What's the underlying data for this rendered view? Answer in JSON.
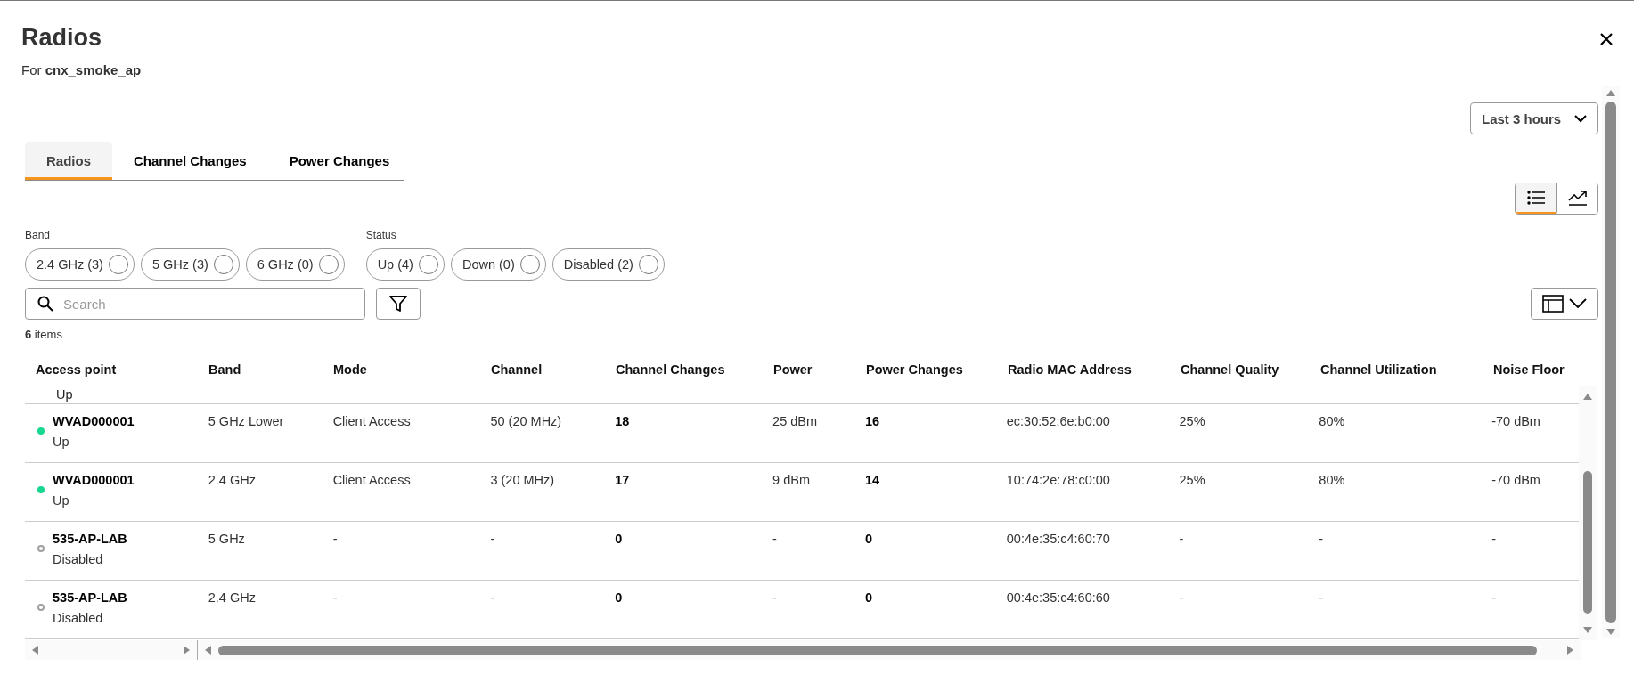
{
  "dialog": {
    "title": "Radios",
    "subtitle_prefix": "For",
    "subtitle_name": "cnx_smoke_ap"
  },
  "time_range": {
    "value": "Last 3 hours"
  },
  "tabs": [
    {
      "label": "Radios",
      "selected": true
    },
    {
      "label": "Channel Changes",
      "selected": false
    },
    {
      "label": "Power Changes",
      "selected": false
    }
  ],
  "view_toggle": [
    {
      "kind": "list",
      "selected": true
    },
    {
      "kind": "chart",
      "selected": false
    }
  ],
  "filters": [
    {
      "label": "Band",
      "chips": [
        {
          "label": "2.4 GHz (3)",
          "selected": false
        },
        {
          "label": "5 GHz (3)",
          "selected": false
        },
        {
          "label": "6 GHz (0)",
          "selected": false
        }
      ]
    },
    {
      "label": "Status",
      "chips": [
        {
          "label": "Up (4)",
          "selected": false
        },
        {
          "label": "Down (0)",
          "selected": false
        },
        {
          "label": "Disabled (2)",
          "selected": false
        }
      ]
    }
  ],
  "search": {
    "placeholder": "Search"
  },
  "item_count": {
    "count": "6",
    "label": "items"
  },
  "table": {
    "columns": [
      "Access point",
      "Band",
      "Mode",
      "Channel",
      "Channel Changes",
      "Power",
      "Power Changes",
      "Radio MAC Address",
      "Channel Quality",
      "Channel Utilization",
      "Noise Floor"
    ],
    "partial_row": {
      "status": "Up"
    },
    "rows": [
      {
        "kind": "up",
        "color": "#17d68f",
        "status": "Up",
        "cells": [
          "WVAD000001",
          "5 GHz Lower",
          "Client Access",
          "50 (20 MHz)",
          "18",
          "25 dBm",
          "16",
          "ec:30:52:6e:b0:00",
          "25%",
          "80%",
          "-70 dBm"
        ]
      },
      {
        "kind": "up",
        "color": "#17d68f",
        "status": "Up",
        "cells": [
          "WVAD000001",
          "2.4 GHz",
          "Client Access",
          "3 (20 MHz)",
          "17",
          "9 dBm",
          "14",
          "10:74:2e:78:c0:00",
          "25%",
          "80%",
          "-70 dBm"
        ]
      },
      {
        "kind": "disabled",
        "color": "#a0a0a0",
        "status": "Disabled",
        "cells": [
          "535-AP-LAB",
          "5 GHz",
          "-",
          "-",
          "0",
          "-",
          "0",
          "00:4e:35:c4:60:70",
          "-",
          "-",
          "-"
        ]
      },
      {
        "kind": "disabled",
        "color": "#a0a0a0",
        "status": "Disabled",
        "cells": [
          "535-AP-LAB",
          "2.4 GHz",
          "-",
          "-",
          "0",
          "-",
          "0",
          "00:4e:35:c4:60:60",
          "-",
          "-",
          "-"
        ]
      }
    ]
  }
}
